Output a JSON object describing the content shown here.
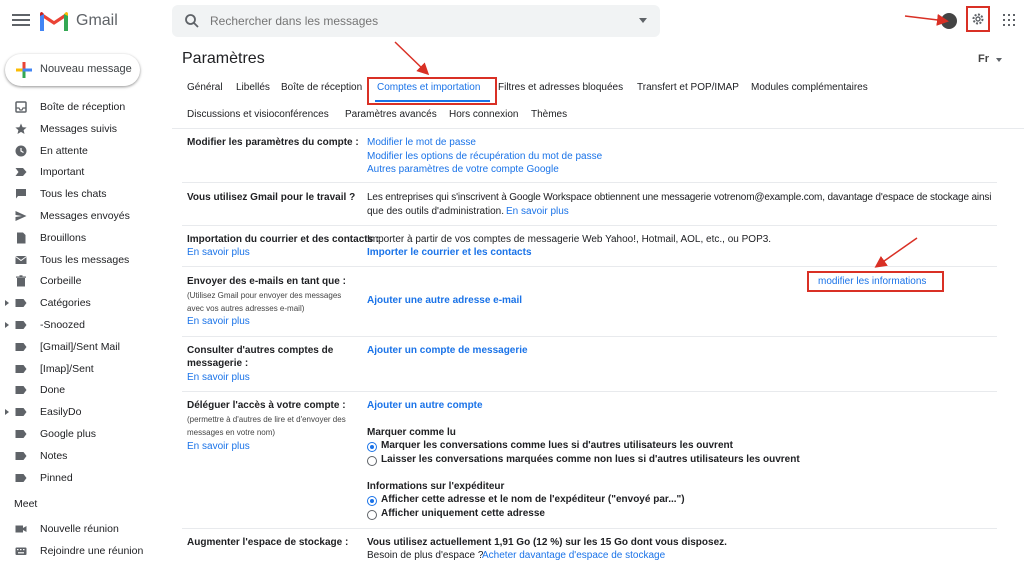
{
  "app": {
    "name": "Gmail"
  },
  "search": {
    "placeholder": "Rechercher dans les messages"
  },
  "compose": {
    "label": "Nouveau message"
  },
  "sidebar": {
    "items": [
      {
        "label": "Boîte de réception",
        "icon": "inbox-icon",
        "caret": false
      },
      {
        "label": "Messages suivis",
        "icon": "star-icon",
        "caret": false
      },
      {
        "label": "En attente",
        "icon": "clock-icon",
        "caret": false
      },
      {
        "label": "Important",
        "icon": "important-icon",
        "caret": false
      },
      {
        "label": "Tous les chats",
        "icon": "chat-icon",
        "caret": false
      },
      {
        "label": "Messages envoyés",
        "icon": "send-icon",
        "caret": false
      },
      {
        "label": "Brouillons",
        "icon": "draft-icon",
        "caret": false
      },
      {
        "label": "Tous les messages",
        "icon": "mail-icon",
        "caret": false
      },
      {
        "label": "Corbeille",
        "icon": "trash-icon",
        "caret": false
      },
      {
        "label": "Catégories",
        "icon": "label-icon",
        "caret": true
      },
      {
        "label": "-Snoozed",
        "icon": "label-icon",
        "caret": true
      },
      {
        "label": "[Gmail]/Sent Mail",
        "icon": "label-icon",
        "caret": false
      },
      {
        "label": "[Imap]/Sent",
        "icon": "label-icon",
        "caret": false
      },
      {
        "label": "Done",
        "icon": "label-icon",
        "caret": false
      },
      {
        "label": "EasilyDo",
        "icon": "label-icon",
        "caret": true
      },
      {
        "label": "Google plus",
        "icon": "label-icon",
        "caret": false
      },
      {
        "label": "Notes",
        "icon": "label-icon",
        "caret": false
      },
      {
        "label": "Pinned",
        "icon": "label-icon",
        "caret": false
      }
    ],
    "meet": {
      "title": "Meet",
      "items": [
        {
          "label": "Nouvelle réunion",
          "icon": "video-icon"
        },
        {
          "label": "Rejoindre une réunion",
          "icon": "keyboard-icon"
        }
      ]
    }
  },
  "settings": {
    "title": "Paramètres",
    "language_short": "Fr",
    "tabs_row1": [
      "Général",
      "Libellés",
      "Boîte de réception",
      "Comptes et importation",
      "Filtres et adresses bloquées",
      "Transfert et POP/IMAP",
      "Modules complémentaires"
    ],
    "tabs_row2": [
      "Discussions et visioconférences",
      "Paramètres avancés",
      "Hors connexion",
      "Thèmes"
    ],
    "active_tab": "Comptes et importation",
    "sections": {
      "account": {
        "label": "Modifier les paramètres du compte :",
        "links": [
          "Modifier le mot de passe",
          "Modifier les options de récupération du mot de passe",
          "Autres paramètres de votre compte Google"
        ]
      },
      "work": {
        "label": "Vous utilisez Gmail pour le travail ?",
        "text_line1": "Les entreprises qui s'inscrivent à Google Workspace obtiennent une messagerie votrenom@example.com, davantage d'espace de stockage ainsi",
        "text_line2": "que des outils d'administration.",
        "link": "En savoir plus"
      },
      "import": {
        "label": "Importation du courrier et des contacts :",
        "learn_more": "En savoir plus",
        "text": "Importer à partir de vos comptes de messagerie Web Yahoo!, Hotmail, AOL, etc., ou POP3.",
        "action": "Importer le courrier et les contacts"
      },
      "send_as": {
        "label": "Envoyer des e-mails en tant que :",
        "sub1": "(Utilisez Gmail pour envoyer des messages",
        "sub2": "avec vos autres adresses e-mail)",
        "learn_more": "En savoir plus",
        "action": "Ajouter une autre adresse e-mail",
        "edit_link": "modifier les informations"
      },
      "check_mail": {
        "label1": "Consulter d'autres comptes de",
        "label2": "messagerie :",
        "learn_more": "En savoir plus",
        "action": "Ajouter un compte de messagerie"
      },
      "delegate": {
        "label": "Déléguer l'accès à votre compte :",
        "sub1": "(permettre à d'autres de lire et d'envoyer des",
        "sub2": "messages en votre nom)",
        "learn_more": "En savoir plus",
        "action": "Ajouter un autre compte",
        "mark_as_read_title": "Marquer comme lu",
        "mark_option1": "Marquer les conversations comme lues si d'autres utilisateurs les ouvrent",
        "mark_option2": "Laisser les conversations marquées comme non lues si d'autres utilisateurs les ouvrent",
        "sender_info_title": "Informations sur l'expéditeur",
        "sender_option1": "Afficher cette adresse et le nom de l'expéditeur (\"envoyé par...\")",
        "sender_option2": "Afficher uniquement cette adresse"
      },
      "storage": {
        "label": "Augmenter l'espace de stockage :",
        "usage": "Vous utilisez actuellement 1,91 Go (12 %) sur les 15 Go dont vous disposez.",
        "more_space": "Besoin de plus d'espace ?",
        "buy_link": "Acheter davantage d'espace de stockage"
      }
    }
  },
  "colors": {
    "accent": "#1a73e8",
    "annotation_red": "#d93025"
  }
}
